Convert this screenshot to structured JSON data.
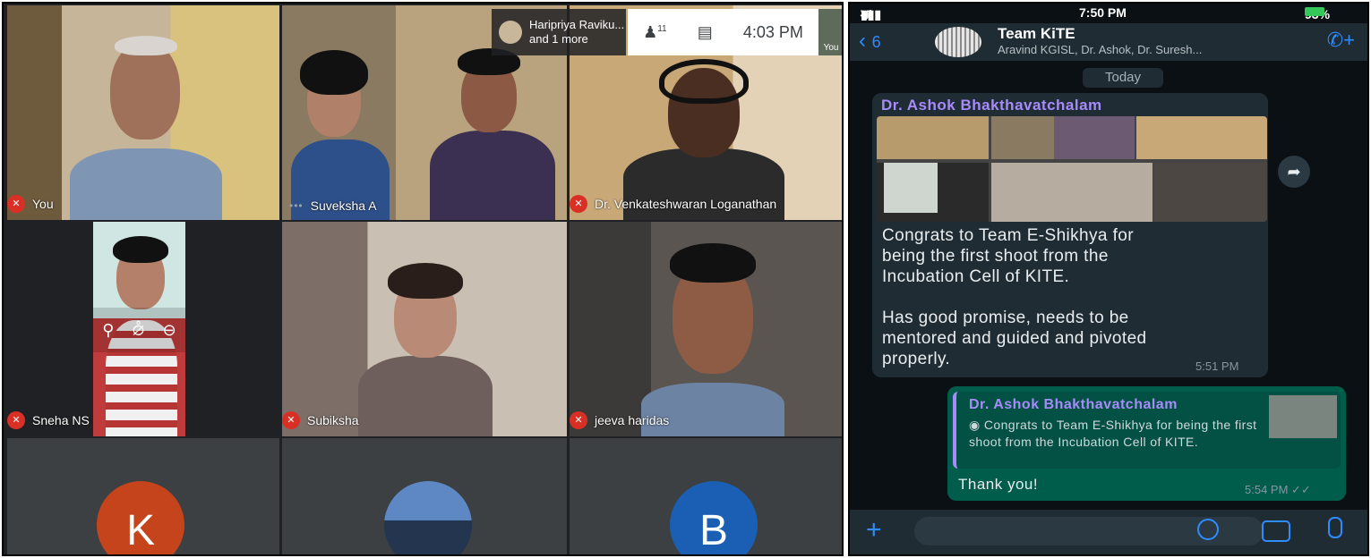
{
  "meet": {
    "top_chip": {
      "line1": "Haripriya Raviku...",
      "line2": "and 1 more"
    },
    "people_count": "11",
    "clock": "4:03 PM",
    "self_mini_label": "You",
    "tiles": [
      {
        "name": "You",
        "status": "mic-off"
      },
      {
        "name": "Suveksha A",
        "status": "speaking"
      },
      {
        "name": "Dr. Venkateshwaran Loganathan",
        "status": "mic-off"
      },
      {
        "name": "Sneha NS",
        "status": "mic-off"
      },
      {
        "name": "Subiksha",
        "status": "mic-off"
      },
      {
        "name": "jeeva haridas",
        "status": "mic-off"
      }
    ],
    "avatars": [
      {
        "letter": "K",
        "color": "#c5441c"
      },
      {
        "letter": "",
        "color": "#3b5f8f"
      },
      {
        "letter": "B",
        "color": "#1a5fb4"
      }
    ]
  },
  "whatsapp": {
    "status": {
      "carrier": "Vi India",
      "time": "7:50 PM",
      "battery": "93%"
    },
    "back_count": "6",
    "group_title": "Team KiTE",
    "group_members": "Aravind KGISL, Dr. Ashok, Dr. Suresh...",
    "day_label": "Today",
    "incoming": {
      "sender": "Dr. Ashok Bhakthavatchalam",
      "text": "Congrats to Team E-Shikhya for\nbeing the first shoot from the\nIncubation Cell of KITE.\n\nHas good promise, needs to be\nmentored and guided and pivoted\nproperly.",
      "time": "5:51 PM"
    },
    "outgoing": {
      "quote_sender": "Dr. Ashok Bhakthavatchalam",
      "quote_text": "Congrats to Team E-Shikhya for being the first shoot from the Incubation Cell of KITE.",
      "text": "Thank you!",
      "time": "5:54 PM"
    },
    "accent_color": "#a78bfa"
  }
}
